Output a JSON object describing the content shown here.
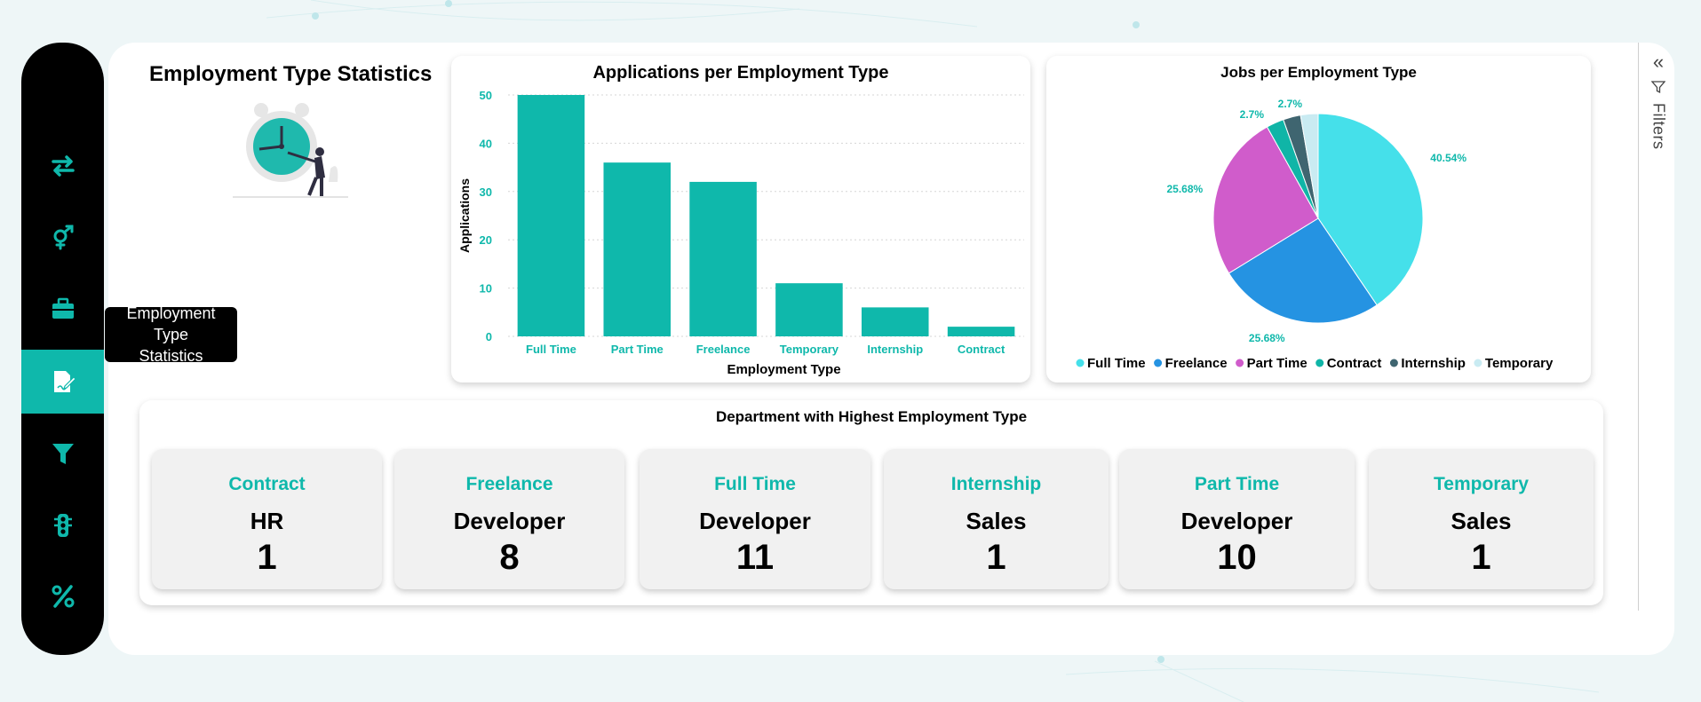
{
  "page_title": "Employment Type Statistics",
  "sidebar": {
    "items": [
      {
        "icon": "swap-arrows-icon",
        "active": false
      },
      {
        "icon": "gender-icon",
        "active": false
      },
      {
        "icon": "briefcase-icon",
        "active": false
      },
      {
        "icon": "document-edit-icon",
        "active": true
      },
      {
        "icon": "filter-funnel-icon",
        "active": false
      },
      {
        "icon": "traffic-light-icon",
        "active": false
      },
      {
        "icon": "percent-icon",
        "active": false
      }
    ],
    "tooltip_line1": "Employment Type",
    "tooltip_line2": "Statistics"
  },
  "filters": {
    "label": "Filters"
  },
  "colors": {
    "accent": "#0fb8ab",
    "sidebar_bg": "#000000",
    "full_time": "#45e0ea",
    "freelance": "#2593e2",
    "part_time": "#d05ccb",
    "contract": "#10b5a7",
    "internship": "#3f6570",
    "temporary": "#c9ebf2"
  },
  "chart_data": [
    {
      "type": "bar",
      "title": "Applications per Employment Type",
      "xlabel": "Employment Type",
      "ylabel": "Applications",
      "categories": [
        "Full Time",
        "Part Time",
        "Freelance",
        "Temporary",
        "Internship",
        "Contract"
      ],
      "values": [
        50,
        36,
        32,
        11,
        6,
        2
      ],
      "ylim": [
        0,
        50
      ],
      "yticks": [
        0,
        10,
        20,
        30,
        40,
        50
      ],
      "grid": true
    },
    {
      "type": "pie",
      "title": "Jobs per Employment Type",
      "legend_position": "bottom",
      "slices": [
        {
          "name": "Full Time",
          "value": 40.54,
          "label": "40.54%"
        },
        {
          "name": "Freelance",
          "value": 25.68,
          "label": "25.68%"
        },
        {
          "name": "Part Time",
          "value": 25.68,
          "label": "25.68%"
        },
        {
          "name": "Contract",
          "value": 2.7,
          "label": "2.7%"
        },
        {
          "name": "Internship",
          "value": 2.7,
          "label": "2.7%"
        },
        {
          "name": "Temporary",
          "value": 2.7,
          "label": "2.7%"
        }
      ]
    }
  ],
  "department_panel": {
    "title": "Department with Highest Employment Type",
    "tiles": [
      {
        "type": "Contract",
        "department": "HR",
        "count": "1"
      },
      {
        "type": "Freelance",
        "department": "Developer",
        "count": "8"
      },
      {
        "type": "Full Time",
        "department": "Developer",
        "count": "11"
      },
      {
        "type": "Internship",
        "department": "Sales",
        "count": "1"
      },
      {
        "type": "Part Time",
        "department": "Developer",
        "count": "10"
      },
      {
        "type": "Temporary",
        "department": "Sales",
        "count": "1"
      }
    ]
  }
}
